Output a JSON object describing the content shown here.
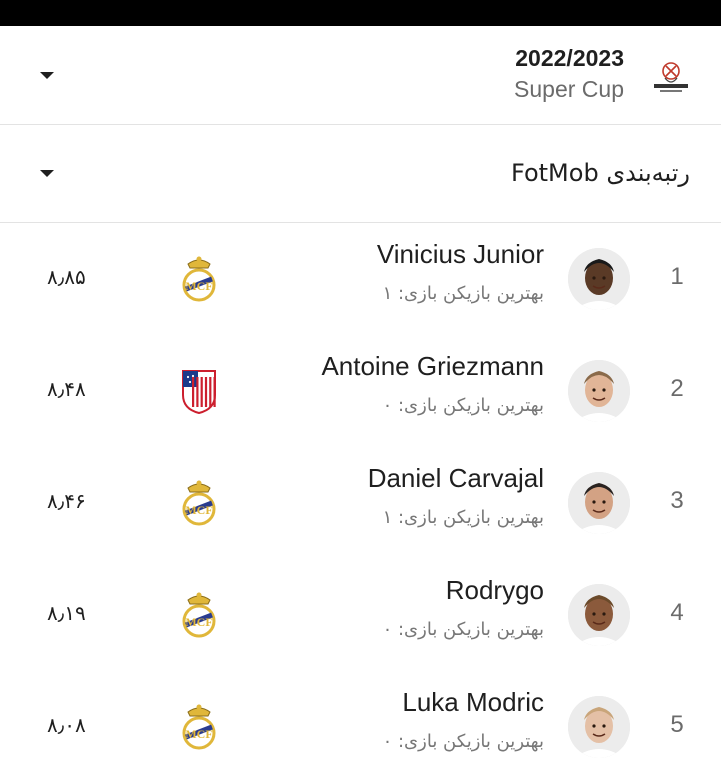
{
  "season": {
    "year": "2022/2023",
    "competition": "Super Cup",
    "logo_icon": "supercopa-trophy-icon"
  },
  "ranking": {
    "title": "رتبه‌بندی FotMob"
  },
  "players": [
    {
      "rank": "1",
      "name": "Vinicius Junior",
      "subtitle": "بهترین بازیکن بازی: ۱",
      "club_icon": "real-madrid-crest-icon",
      "rating": "۸٫۸۵",
      "skin": "#5a3a26",
      "hair": "#1a1a1a"
    },
    {
      "rank": "2",
      "name": "Antoine Griezmann",
      "subtitle": "بهترین بازیکن بازی: ۰",
      "club_icon": "atletico-madrid-crest-icon",
      "rating": "۸٫۴۸",
      "skin": "#e1b597",
      "hair": "#8a6a4a"
    },
    {
      "rank": "3",
      "name": "Daniel Carvajal",
      "subtitle": "بهترین بازیکن بازی: ۱",
      "club_icon": "real-madrid-crest-icon",
      "rating": "۸٫۴۶",
      "skin": "#d3a284",
      "hair": "#2a2320"
    },
    {
      "rank": "4",
      "name": "Rodrygo",
      "subtitle": "بهترین بازیکن بازی: ۰",
      "club_icon": "real-madrid-crest-icon",
      "rating": "۸٫۱۹",
      "skin": "#8b5a3c",
      "hair": "#6b4a2a"
    },
    {
      "rank": "5",
      "name": "Luka Modric",
      "subtitle": "بهترین بازیکن بازی: ۰",
      "club_icon": "real-madrid-crest-icon",
      "rating": "۸٫۰۸",
      "skin": "#e4c0a6",
      "hair": "#c9a57a"
    }
  ],
  "colors": {
    "real_madrid_gold": "#e0b73a",
    "real_madrid_blue": "#2a3c8f",
    "atletico_red": "#cc1f2e",
    "atletico_blue": "#1b3a8a"
  }
}
